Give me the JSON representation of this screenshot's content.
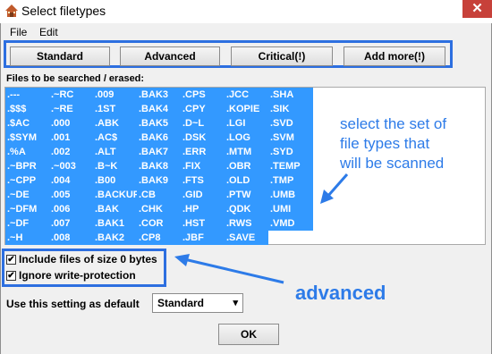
{
  "window": {
    "title": "Select filetypes",
    "close_glyph": "✕",
    "app_icon": "house-icon"
  },
  "menu": [
    "File",
    "Edit"
  ],
  "buttons": [
    "Standard",
    "Advanced",
    "Critical(!)",
    "Add more(!)"
  ],
  "files_label": "Files to be searched / erased:",
  "file_columns": [
    [
      ".---",
      ".$$$",
      ".$AC",
      ".$SYM",
      ".%A",
      ".~BPR",
      ".~CPP",
      ".~DE",
      ".~DFM",
      ".~DF",
      ".~H"
    ],
    [
      ".~RC",
      ".~RE",
      ".000",
      ".001",
      ".002",
      ".~003",
      ".004",
      ".005",
      ".006",
      ".007",
      ".008"
    ],
    [
      ".009",
      ".1ST",
      ".ABK",
      ".AC$",
      ".ALT",
      ".B~K",
      ".B00",
      ".BACKUP",
      ".BAK",
      ".BAK1",
      ".BAK2"
    ],
    [
      ".BAK3",
      ".BAK4",
      ".BAK5",
      ".BAK6",
      ".BAK7",
      ".BAK8",
      ".BAK9",
      ".CB",
      ".CHK",
      ".COR",
      ".CP8"
    ],
    [
      ".CPS",
      ".CPY",
      ".D~L",
      ".DSK",
      ".ERR",
      ".FIX",
      ".FTS",
      ".GID",
      ".HP",
      ".HST",
      ".JBF"
    ],
    [
      ".JCC",
      ".KOPIE",
      ".LGI",
      ".LOG",
      ".MTM",
      ".OBR",
      ".OLD",
      ".PTW",
      ".QDK",
      ".RWS",
      ".SAVE"
    ],
    [
      ".SHA",
      ".SIK",
      ".SVD",
      ".SVM",
      ".SYD",
      ".TEMP",
      ".TMP",
      ".UMB",
      ".UMI",
      ".VMD"
    ]
  ],
  "annotations": {
    "filetypes_note": [
      "select the set of",
      "file types that",
      "will be scanned"
    ],
    "advanced_note": "advanced"
  },
  "checkboxes": [
    {
      "label": "Include files of size 0 bytes",
      "checked": true,
      "mark": "✔"
    },
    {
      "label": "Ignore write-protection",
      "checked": true,
      "mark": "✔"
    }
  ],
  "default_label": "Use this setting as default",
  "default_select": {
    "value": "Standard",
    "caret": "▾"
  },
  "ok_label": "OK",
  "colors": {
    "selection": "#3399ff",
    "annotation": "#2d7be8",
    "close": "#c7413a"
  }
}
